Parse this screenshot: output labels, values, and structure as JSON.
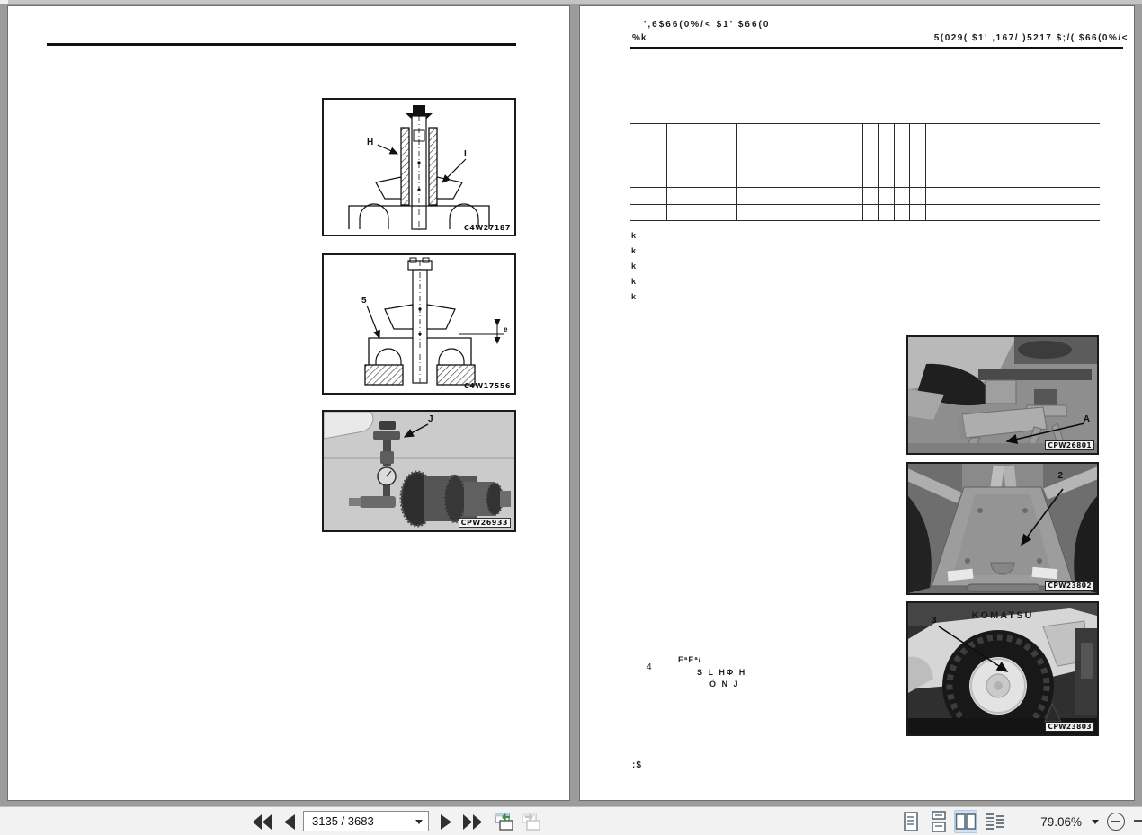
{
  "pages": {
    "left": {
      "figures": [
        {
          "code": "C4W27187",
          "labels": [
            "H",
            "I"
          ]
        },
        {
          "code": "C4W17556",
          "labels": [
            "5",
            "e"
          ]
        },
        {
          "code": "CPW26933",
          "labels": [
            "J"
          ]
        }
      ]
    },
    "right": {
      "header": {
        "title_line1": "',6$66(0%/< $1' $66(0",
        "title_line2": "%k",
        "section_title": "5(029( $1' ,167/ )5217 $;/( $66(0%/<"
      },
      "bullets": [
        "k",
        "k",
        "k",
        "k",
        "k"
      ],
      "step": {
        "number": "4",
        "line1": "EªEª/",
        "line2": "S L HΦ H",
        "line3": "Ó N J"
      },
      "footer": ":$",
      "photos": [
        {
          "code": "CPW26801",
          "label": "A"
        },
        {
          "code": "CPW23802",
          "label": "2"
        },
        {
          "code": "CPW23803",
          "label": "3",
          "overlay_text": "KOMATSU"
        }
      ]
    }
  },
  "toolbar": {
    "page_field_value": "3135 / 3683",
    "zoom_value": "79.06%",
    "icons": {
      "first_page": "double-left-triangles",
      "previous_page": "left-triangle",
      "next_page": "right-triangle",
      "last_page": "double-right-triangles",
      "previous_view": "window-with-green-back-arrow",
      "next_view": "window-with-gray-forward-arrow",
      "single_page_view": "single-page",
      "continuous_view": "continuous-pages",
      "two_page_view": "facing-pages",
      "two_page_continuous_view": "facing-pages-continuous",
      "zoom_out": "circled-minus",
      "page_dropdown": "caret-down",
      "zoom_dropdown": "caret-down"
    },
    "colors": {
      "selected_view_bg": "#cfe3f5",
      "green_arrow": "#3f9142",
      "icon_dark": "#2f2f2f"
    }
  },
  "colors": {
    "canvas_bg": "#9c9c9c",
    "page_bg": "#ffffff",
    "toolbar_bg": "#f2f2f2"
  }
}
